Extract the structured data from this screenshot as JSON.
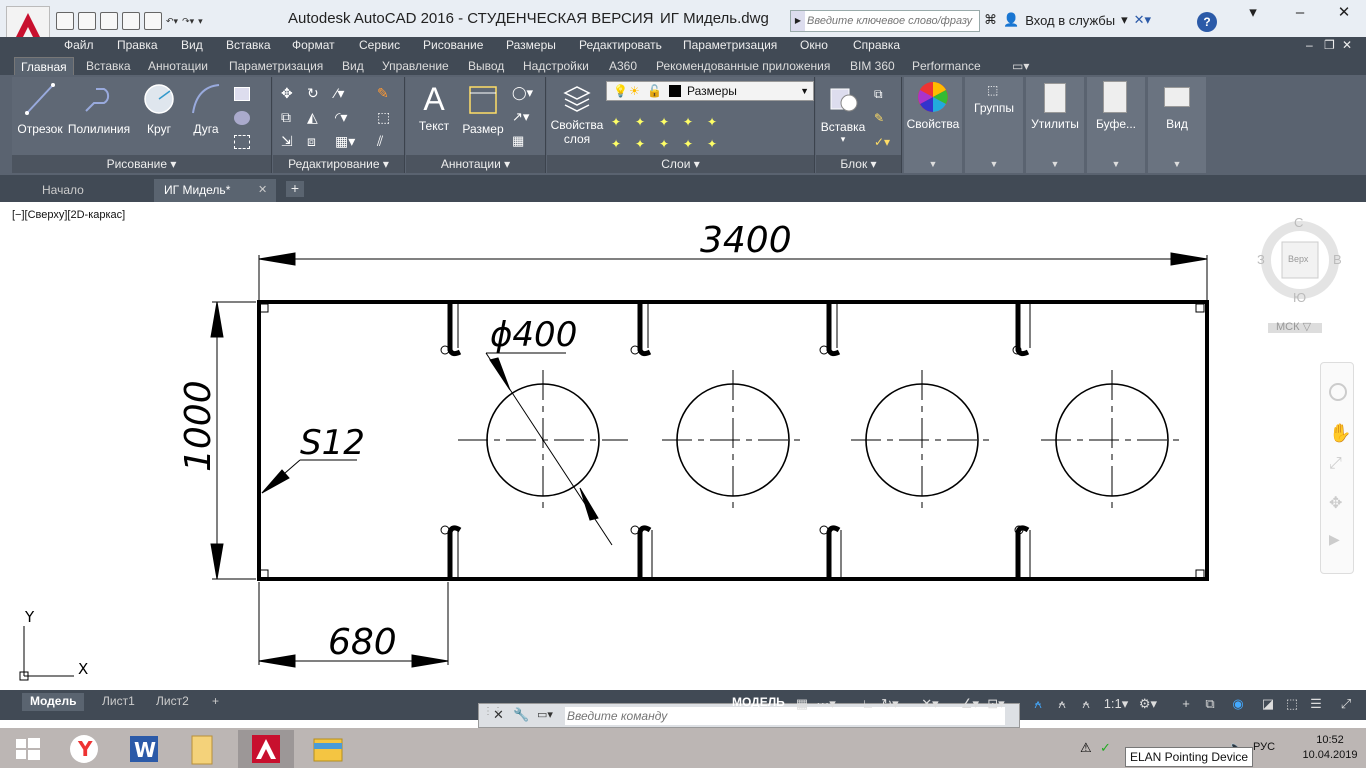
{
  "titlebar": {
    "app_title": "Autodesk AutoCAD 2016 - СТУДЕНЧЕСКАЯ ВЕРСИЯ",
    "file_name": "ИГ Мидель.dwg",
    "search_placeholder": "Введите ключевое слово/фразу",
    "login_label": "Вход в службы",
    "help_label": "?",
    "minimize": "–",
    "maximize": "☐",
    "close": "✕"
  },
  "menu": [
    "Файл",
    "Правка",
    "Вид",
    "Вставка",
    "Формат",
    "Сервис",
    "Рисование",
    "Размеры",
    "Редактировать",
    "Параметризация",
    "Окно",
    "Справка"
  ],
  "ribbon_tabs": [
    "Главная",
    "Вставка",
    "Аннотации",
    "Параметризация",
    "Вид",
    "Управление",
    "Вывод",
    "Надстройки",
    "A360",
    "Рекомендованные приложения",
    "BIM 360",
    "Performance"
  ],
  "panels": {
    "draw": {
      "title": "Рисование",
      "tools": [
        "Отрезок",
        "Полилиния",
        "Круг",
        "Дуга"
      ]
    },
    "modify": {
      "title": "Редактирование"
    },
    "annotation": {
      "title": "Аннотации",
      "tools": [
        "Текст",
        "Размер"
      ]
    },
    "layers": {
      "title": "Слои",
      "props_label": "Свойства слоя",
      "layer_name": "Размеры"
    },
    "block": {
      "title": "Блок",
      "insert_label": "Вставка"
    },
    "properties": {
      "label": "Свойства"
    },
    "groups": {
      "label": "Группы"
    },
    "utilities": {
      "label": "Утилиты"
    },
    "clipboard": {
      "label": "Буфе..."
    },
    "view": {
      "label": "Вид"
    }
  },
  "file_tabs": {
    "start": "Начало",
    "current": "ИГ Мидель*",
    "add": "+"
  },
  "viewport_label": "[−][Сверху][2D-каркас]",
  "drawing": {
    "dim_overall_length": "3400",
    "dim_height": "1000",
    "dim_hole_diameter": "ϕ400",
    "dim_thickness": "S12",
    "dim_offset": "680",
    "hole_count": 4,
    "ucs_x": "X",
    "ucs_y": "Y"
  },
  "navcube": {
    "north": "С",
    "south": "Ю",
    "west": "З",
    "east": "В",
    "face": "Верх",
    "ucs": "МСК"
  },
  "layout_tabs": [
    "Модель",
    "Лист1",
    "Лист2"
  ],
  "command_placeholder": "Введите команду",
  "status": {
    "model": "МОДЕЛЬ",
    "scale": "1:1"
  },
  "taskbar": {
    "tooltip": "ELAN Pointing Device",
    "lang": "РУС",
    "time": "10:52",
    "date": "10.04.2019"
  },
  "colors": {
    "dark_bar": "#414a55",
    "ribbon": "#5a6370",
    "autocad_red": "#c8102e"
  }
}
